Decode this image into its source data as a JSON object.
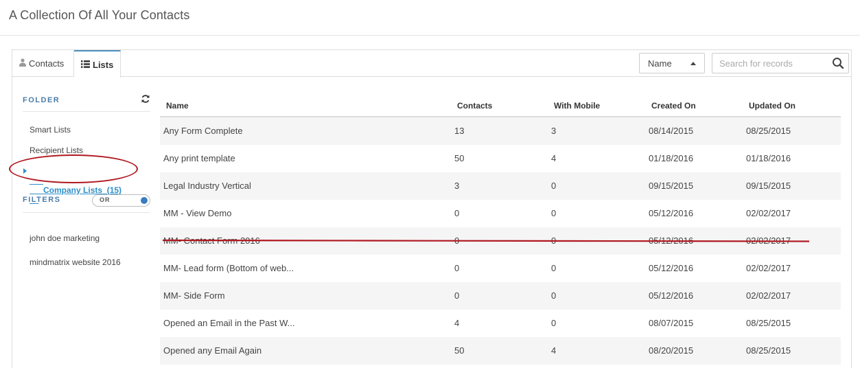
{
  "page": {
    "title": "A Collection Of All Your Contacts"
  },
  "tabs": {
    "contacts_label": "Contacts",
    "lists_label": "Lists"
  },
  "toolbar": {
    "sort_value": "Name",
    "search_placeholder": "Search for records"
  },
  "sidebar": {
    "folder_label": "FOLDER",
    "items": [
      {
        "label": "Smart Lists"
      },
      {
        "label": "Recipient Lists"
      },
      {
        "label": "Company Lists  (15)"
      }
    ],
    "filters_label": "FILTERS",
    "toggle_label": "OR",
    "filters": [
      {
        "label": "john doe marketing"
      },
      {
        "label": "mindmatrix website 2016"
      }
    ]
  },
  "table": {
    "columns": [
      "Name",
      "Contacts",
      "With Mobile",
      "Created On",
      "Updated On"
    ],
    "rows": [
      {
        "name": "Any Form Complete",
        "contacts": "13",
        "mobile": "3",
        "created": "08/14/2015",
        "updated": "08/25/2015"
      },
      {
        "name": "Any print template",
        "contacts": "50",
        "mobile": "4",
        "created": "01/18/2016",
        "updated": "01/18/2016"
      },
      {
        "name": "Legal Industry Vertical",
        "contacts": "3",
        "mobile": "0",
        "created": "09/15/2015",
        "updated": "09/15/2015"
      },
      {
        "name": "MM - View Demo",
        "contacts": "0",
        "mobile": "0",
        "created": "05/12/2016",
        "updated": "02/02/2017"
      },
      {
        "name": "MM- Contact Form 2016",
        "contacts": "0",
        "mobile": "0",
        "created": "05/12/2016",
        "updated": "02/02/2017"
      },
      {
        "name": "MM- Lead form (Bottom of web...",
        "contacts": "0",
        "mobile": "0",
        "created": "05/12/2016",
        "updated": "02/02/2017"
      },
      {
        "name": "MM- Side Form",
        "contacts": "0",
        "mobile": "0",
        "created": "05/12/2016",
        "updated": "02/02/2017"
      },
      {
        "name": "Opened an Email in the Past W...",
        "contacts": "4",
        "mobile": "0",
        "created": "08/07/2015",
        "updated": "08/25/2015"
      },
      {
        "name": "Opened any Email Again",
        "contacts": "50",
        "mobile": "4",
        "created": "08/20/2015",
        "updated": "08/25/2015"
      }
    ]
  },
  "colors": {
    "accent": "#2f8fc7",
    "section_label": "#4a7ca8",
    "annotation_red": "#b01820"
  },
  "icons": {
    "contacts_tab": "user-icon",
    "lists_tab": "list-icon",
    "refresh": "refresh-icon",
    "search": "search-icon"
  }
}
